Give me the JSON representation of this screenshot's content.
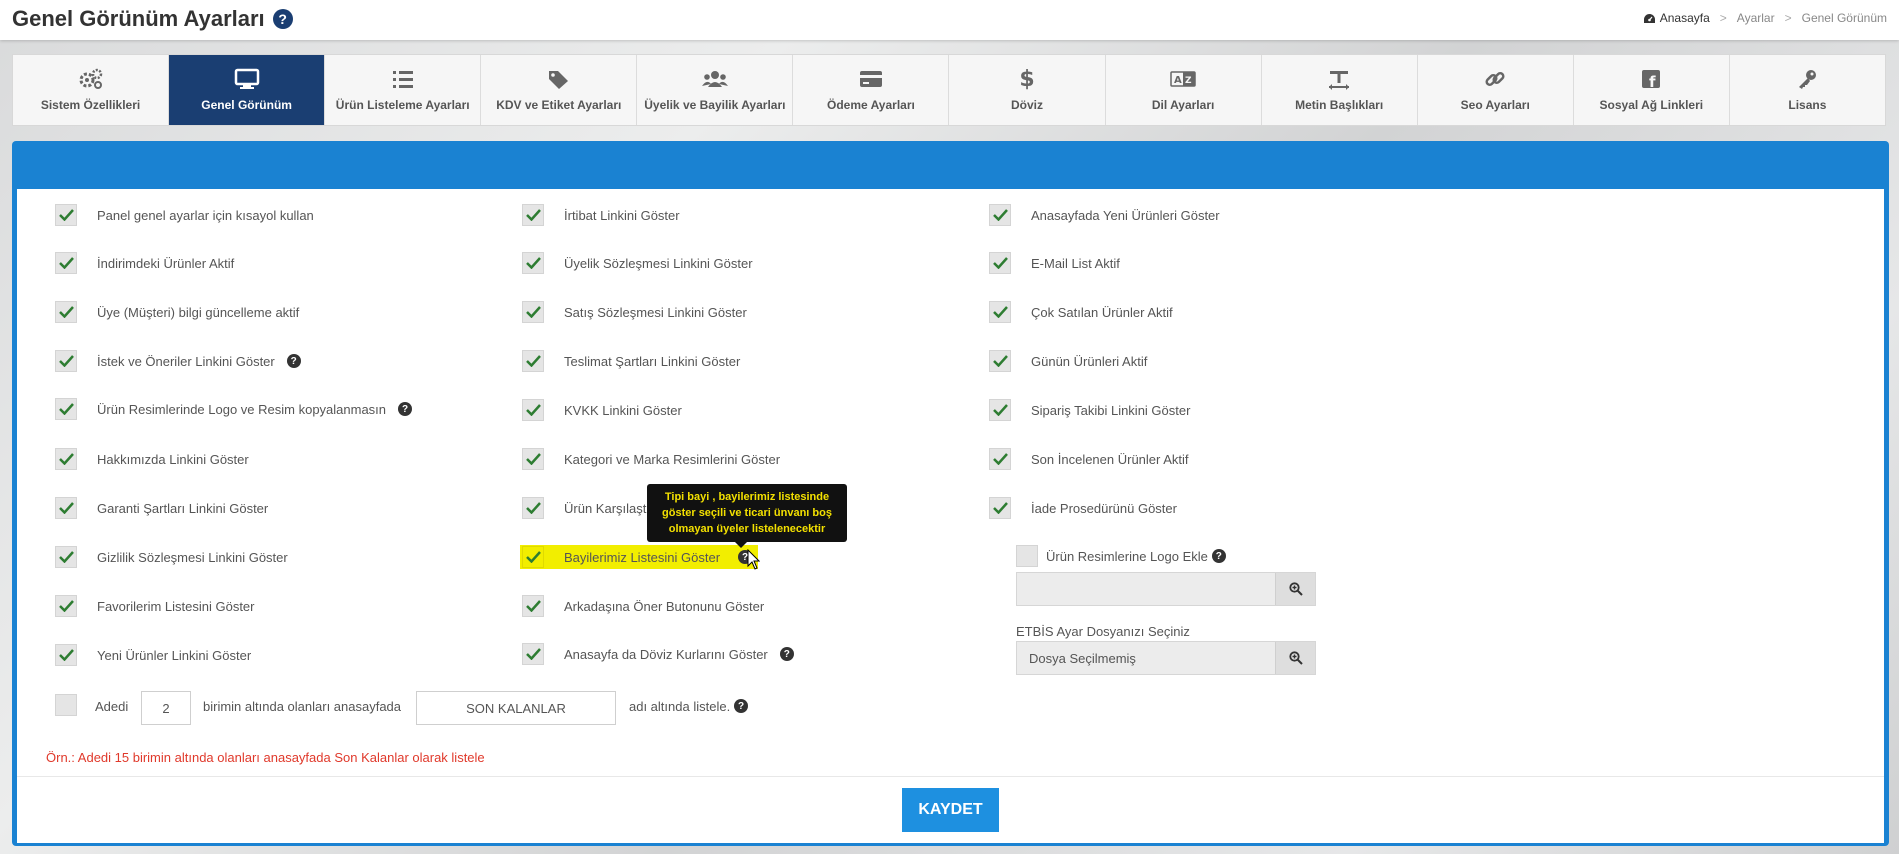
{
  "header": {
    "title": "Genel Görünüm Ayarları",
    "help": "?",
    "breadcrumb": [
      "Anasayfa",
      "Ayarlar",
      "Genel Görünüm"
    ],
    "sep": ">"
  },
  "tabs": [
    {
      "label": "Sistem Özellikleri",
      "icon": "gears-icon"
    },
    {
      "label": "Genel Görünüm",
      "icon": "monitor-icon"
    },
    {
      "label": "Ürün Listeleme Ayarları",
      "icon": "list-icon"
    },
    {
      "label": "KDV ve Etiket Ayarları",
      "icon": "tags-icon"
    },
    {
      "label": "Üyelik ve Bayilik Ayarları",
      "icon": "users-icon"
    },
    {
      "label": "Ödeme Ayarları",
      "icon": "credit-card-icon"
    },
    {
      "label": "Döviz",
      "icon": "dollar-icon"
    },
    {
      "label": "Dil Ayarları",
      "icon": "language-icon"
    },
    {
      "label": "Metin Başlıkları",
      "icon": "text-height-icon"
    },
    {
      "label": "Seo Ayarları",
      "icon": "link-icon"
    },
    {
      "label": "Sosyal Ağ Linkleri",
      "icon": "facebook-icon"
    },
    {
      "label": "Lisans",
      "icon": "key-icon"
    }
  ],
  "active_tab": "Genel Görünüm",
  "col1": [
    {
      "label": "Panel genel ayarlar için kısayol kullan",
      "checked": true,
      "help": false
    },
    {
      "label": "İndirimdeki Ürünler Aktif",
      "checked": true,
      "help": false
    },
    {
      "label": "Üye (Müşteri) bilgi güncelleme aktif",
      "checked": true,
      "help": false
    },
    {
      "label": "İstek ve Öneriler Linkini Göster",
      "checked": true,
      "help": true
    },
    {
      "label": "Ürün Resimlerinde Logo ve Resim kopyalanmasın",
      "checked": true,
      "help": true
    },
    {
      "label": "Hakkımızda Linkini Göster",
      "checked": true,
      "help": false
    },
    {
      "label": "Garanti Şartları Linkini Göster",
      "checked": true,
      "help": false
    },
    {
      "label": "Gizlilik Sözleşmesi Linkini Göster",
      "checked": true,
      "help": false
    },
    {
      "label": "Favorilerim Listesini Göster",
      "checked": true,
      "help": false
    },
    {
      "label": "Yeni Ürünler Linkini Göster",
      "checked": true,
      "help": false
    }
  ],
  "col2": [
    {
      "label": "İrtibat Linkini Göster",
      "checked": true,
      "help": false
    },
    {
      "label": "Üyelik Sözleşmesi Linkini Göster",
      "checked": true,
      "help": false
    },
    {
      "label": "Satış Sözleşmesi Linkini Göster",
      "checked": true,
      "help": false
    },
    {
      "label": "Teslimat Şartları Linkini Göster",
      "checked": true,
      "help": false
    },
    {
      "label": "KVKK Linkini Göster",
      "checked": true,
      "help": false
    },
    {
      "label": "Kategori ve Marka Resimlerini Göster",
      "checked": true,
      "help": false
    },
    {
      "label": "Ürün Karşılaşt",
      "checked": true,
      "help": false
    },
    {
      "label": "Bayilerimiz Listesini Göster",
      "checked": true,
      "help": true
    },
    {
      "label": "Arkadaşına Öner Butonunu Göster",
      "checked": true,
      "help": false
    },
    {
      "label": "Anasayfa da Döviz Kurlarını Göster",
      "checked": true,
      "help": true
    }
  ],
  "col3": [
    {
      "label": "Anasayfada Yeni Ürünleri Göster",
      "checked": true
    },
    {
      "label": "E-Mail List Aktif",
      "checked": true
    },
    {
      "label": "Çok Satılan Ürünler Aktif",
      "checked": true
    },
    {
      "label": "Günün Ürünleri Aktif",
      "checked": true
    },
    {
      "label": "Sipariş Takibi Linkini Göster",
      "checked": true
    },
    {
      "label": "Son İncelenen Ürünler Aktif",
      "checked": true
    },
    {
      "label": "İade Prosedürünü Göster",
      "checked": true
    }
  ],
  "tooltip": "Tipi bayi , bayilerimiz listesinde göster seçili ve ticari ünvanı boş olmayan üyeler listelenecektir",
  "logo_option": {
    "label": "Ürün Resimlerine Logo Ekle",
    "checked": false,
    "file_value": ""
  },
  "etbis": {
    "label": "ETBİS Ayar Dosyanızı Seçiniz",
    "file_value": "Dosya Seçilmemiş"
  },
  "stock_rule": {
    "checked": false,
    "prefix": "Adedi",
    "quantity": "2",
    "middle": "birimin altında olanları anasayfada",
    "section_name": "SON KALANLAR",
    "suffix": "adı altında listele."
  },
  "example_note": "Örn.: Adedi 15 birimin altında olanları anasayfada Son Kalanlar olarak listele",
  "save_label": "KAYDET",
  "colors": {
    "navy": "#1a3e72",
    "blue": "#1a82d2",
    "check": "#2e7d32",
    "note": "#e0392b",
    "highlight": "#f2ee00"
  }
}
